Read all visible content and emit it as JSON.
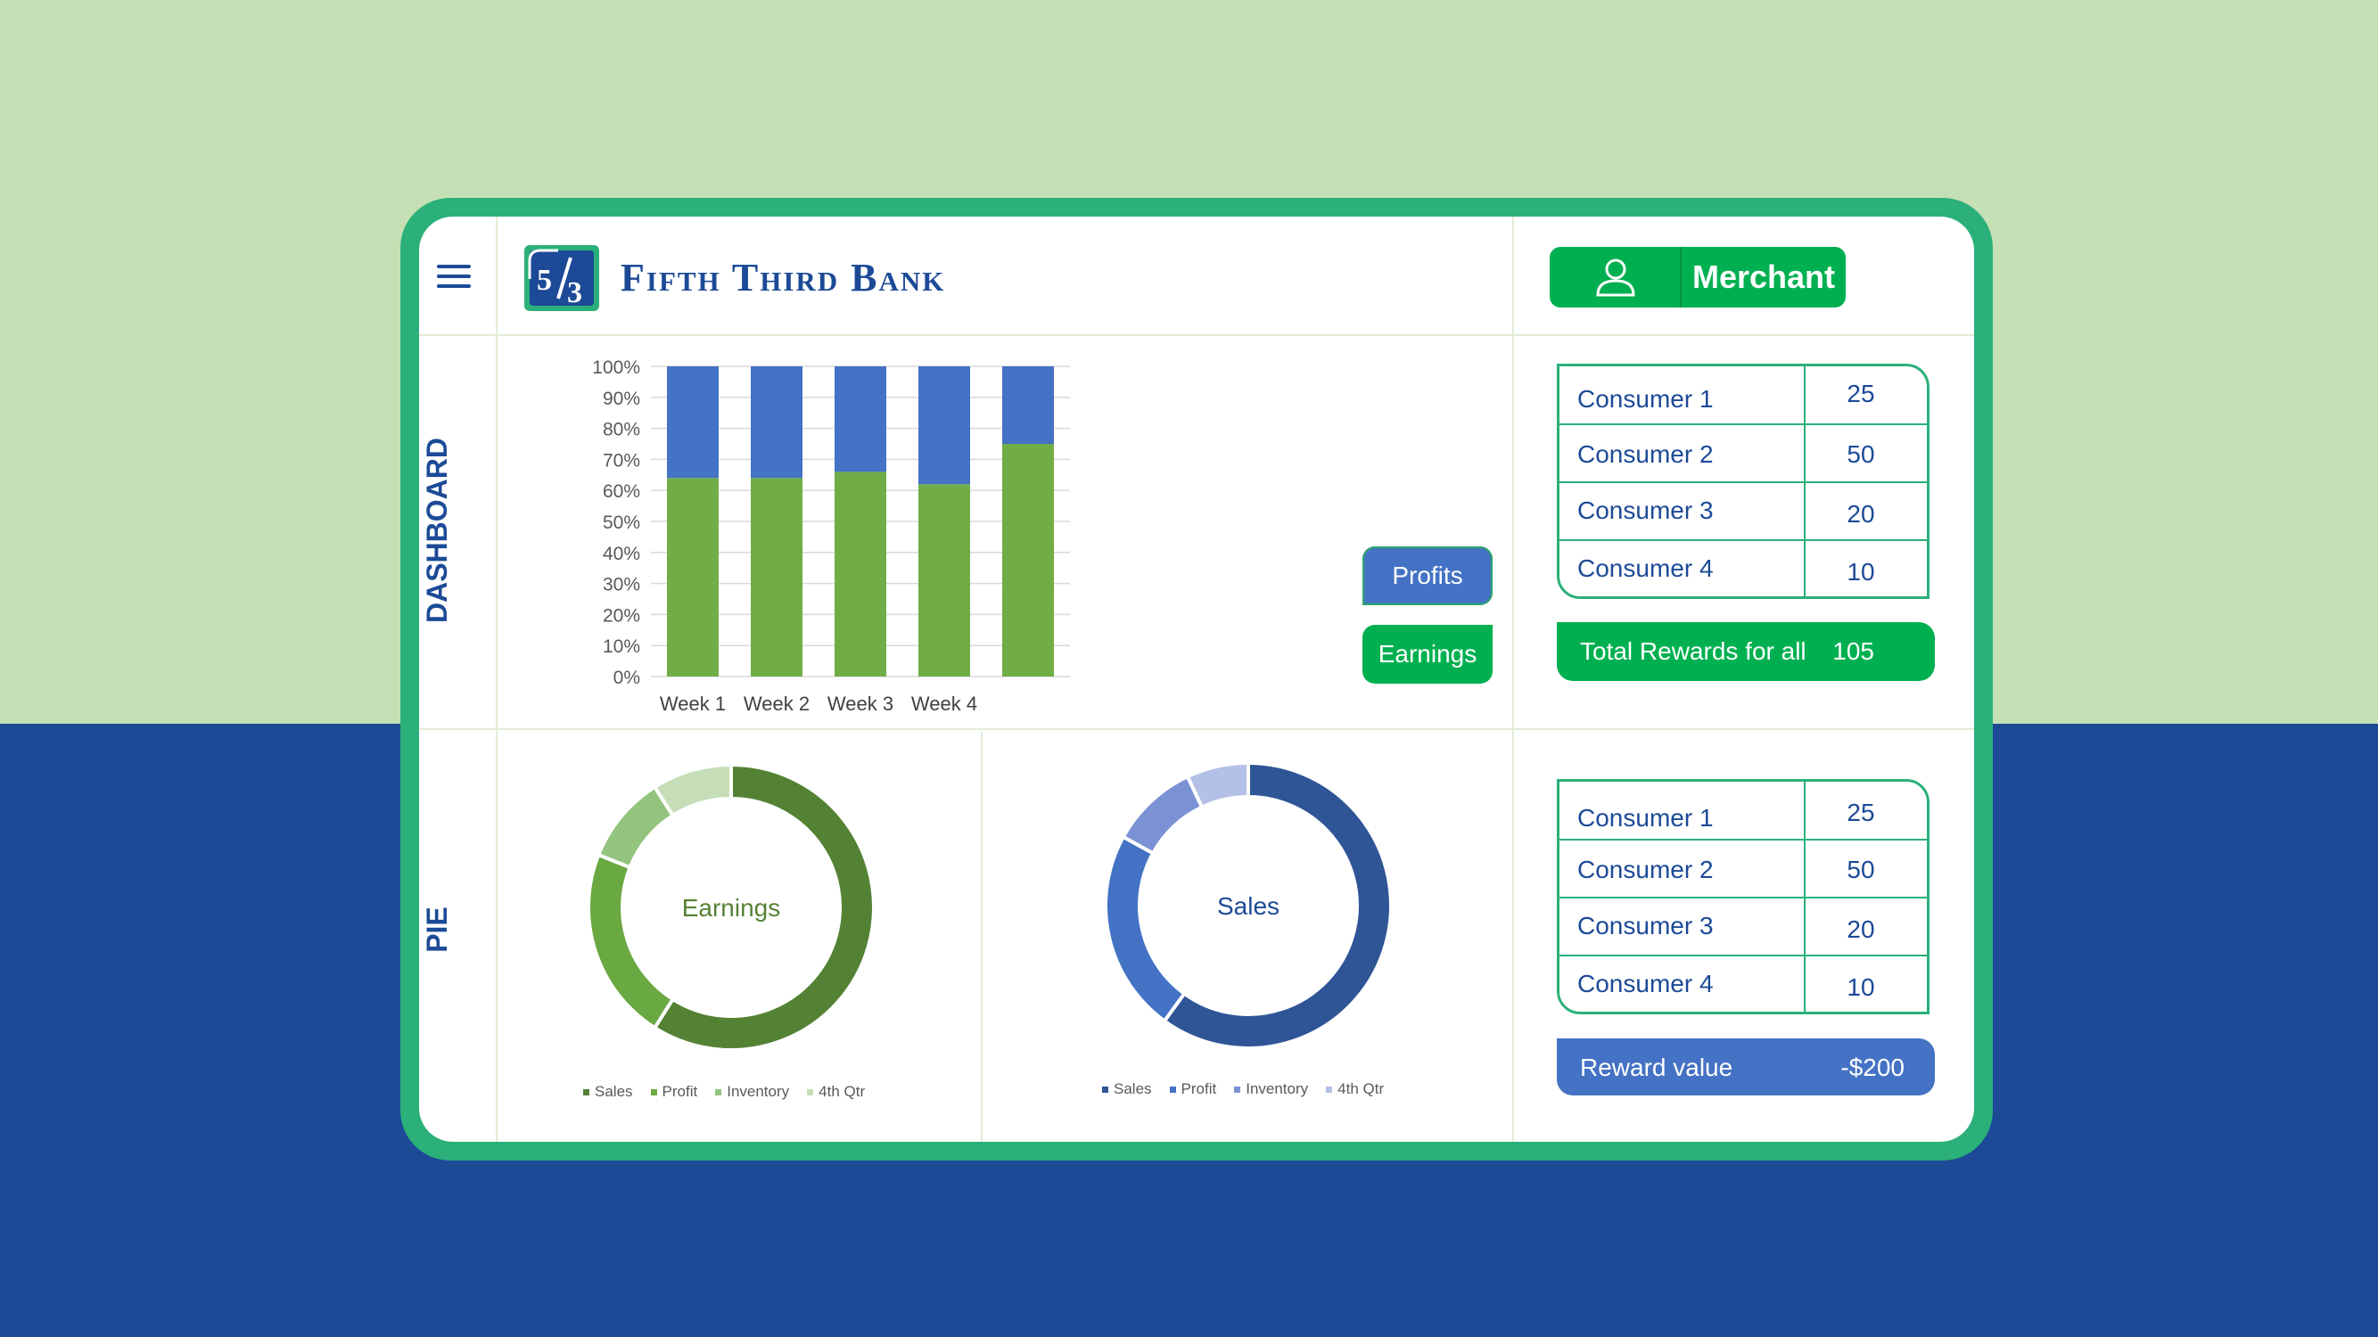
{
  "header": {
    "brand": "Fifth Third Bank",
    "merchant_label": "Merchant"
  },
  "sections": {
    "dashboard": "DASHBOARD",
    "pie": "PIE"
  },
  "buttons": {
    "profits": "Profits",
    "earnings": "Earnings"
  },
  "colors": {
    "green": "#00b050",
    "blue": "#4472c4",
    "navy": "#1c4a97",
    "frame": "#2bb07a",
    "bar_green": "#70ad47"
  },
  "rewards_table": {
    "rows": [
      {
        "name": "Consumer 1",
        "value": "25"
      },
      {
        "name": "Consumer 2",
        "value": "50"
      },
      {
        "name": "Consumer 3",
        "value": "20"
      },
      {
        "name": "Consumer 4",
        "value": "10"
      }
    ],
    "total_label": "Total Rewards for all",
    "total_value": "105"
  },
  "reward_table": {
    "rows": [
      {
        "name": "Consumer 1",
        "value": "25"
      },
      {
        "name": "Consumer 2",
        "value": "50"
      },
      {
        "name": "Consumer 3",
        "value": "20"
      },
      {
        "name": "Consumer 4",
        "value": "10"
      }
    ],
    "reward_label": "Reward value",
    "reward_value": "-$200"
  },
  "chart_data": [
    {
      "type": "bar",
      "stacked": true,
      "categories": [
        "Week 1",
        "Week 2",
        "Week 3",
        "Week 4",
        ""
      ],
      "series": [
        {
          "color": "#70ad47",
          "values": [
            64,
            64,
            66,
            62,
            75
          ]
        },
        {
          "color": "#4472c4",
          "values": [
            36,
            36,
            34,
            38,
            25
          ]
        }
      ],
      "yticks": [
        "0%",
        "10%",
        "20%",
        "30%",
        "40%",
        "50%",
        "60%",
        "70%",
        "80%",
        "90%",
        "100%"
      ],
      "ylim": [
        0,
        100
      ],
      "grid": true
    },
    {
      "type": "pie",
      "donut": true,
      "center_label": "Earnings",
      "labels": [
        "Sales",
        "Profit",
        "Inventory",
        "4th Qtr"
      ],
      "values": [
        59,
        22,
        10,
        9
      ],
      "colors": [
        "#548235",
        "#6aa842",
        "#93c47d",
        "#c5deb8"
      ],
      "label_color": "#548235",
      "legend": "bottom"
    },
    {
      "type": "pie",
      "donut": true,
      "center_label": "Sales",
      "labels": [
        "Sales",
        "Profit",
        "Inventory",
        "4th Qtr"
      ],
      "values": [
        60,
        23,
        10,
        7
      ],
      "colors": [
        "#2f5597",
        "#4472c4",
        "#7a92d4",
        "#b4c1e6"
      ],
      "label_color": "#1c4a97",
      "legend": "bottom"
    }
  ]
}
